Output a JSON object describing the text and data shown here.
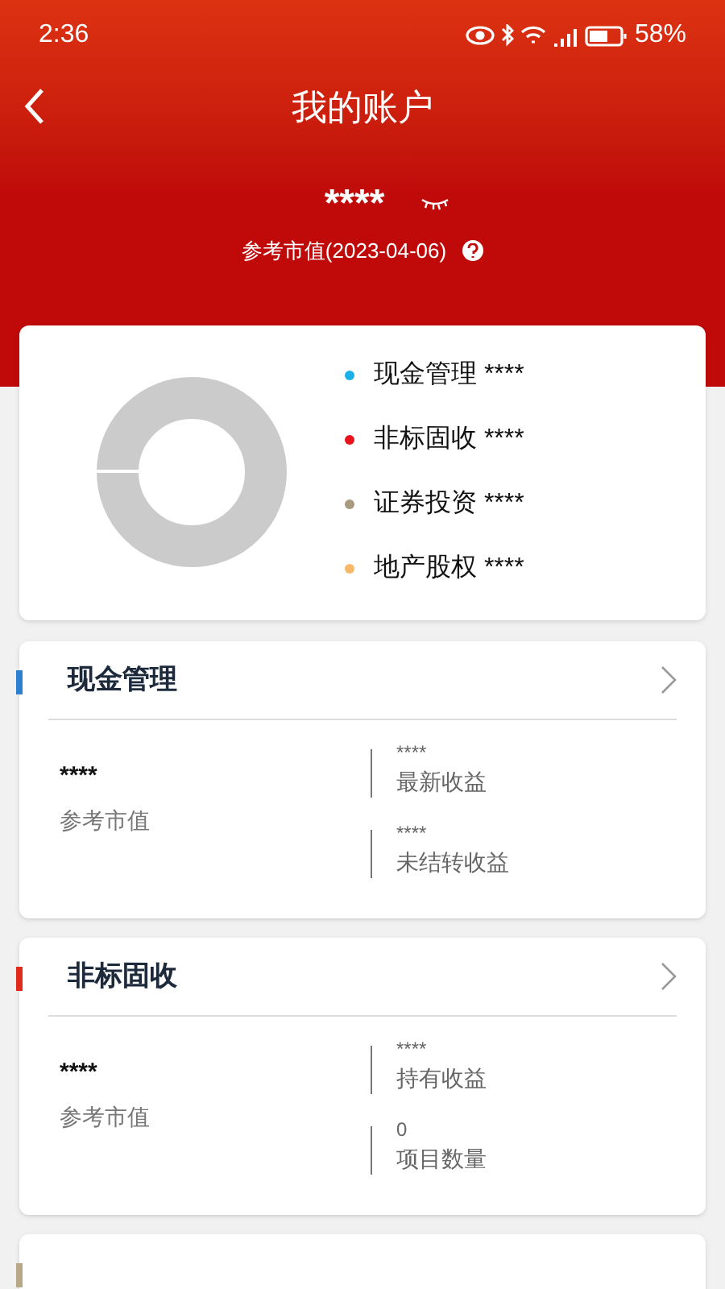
{
  "status_bar": {
    "time": "2:36",
    "battery": "58%"
  },
  "header": {
    "title": "我的账户",
    "amount": "****",
    "subtitle": "参考市值(2023-04-06)"
  },
  "legend": [
    {
      "label": "现金管理 ****",
      "color": "#1ab0e8"
    },
    {
      "label": "非标固收 ****",
      "color": "#e8141c"
    },
    {
      "label": "证券投资 ****",
      "color": "#a99a80"
    },
    {
      "label": "地产股权 ****",
      "color": "#f7b968"
    }
  ],
  "products": [
    {
      "title": "现金管理",
      "color": "#2d7fd0",
      "value": "****",
      "value_label": "参考市值",
      "stats": [
        {
          "value": "****",
          "label": "最新收益"
        },
        {
          "value": "****",
          "label": "未结转收益"
        }
      ]
    },
    {
      "title": "非标固收",
      "color": "#e02a1c",
      "value": "****",
      "value_label": "参考市值",
      "stats": [
        {
          "value": "****",
          "label": "持有收益"
        },
        {
          "value": "0",
          "label": "项目数量"
        }
      ]
    },
    {
      "color": "#b8a88a"
    }
  ]
}
